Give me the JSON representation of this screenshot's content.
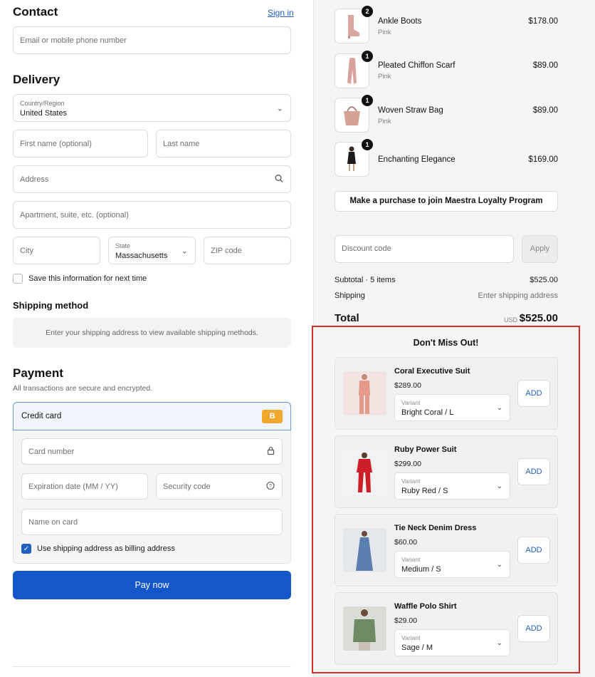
{
  "contact": {
    "title": "Contact",
    "sign_in": "Sign in",
    "email_placeholder": "Email or mobile phone number"
  },
  "delivery": {
    "title": "Delivery",
    "country_label": "Country/Region",
    "country_value": "United States",
    "first_name_placeholder": "First name (optional)",
    "last_name_placeholder": "Last name",
    "address_placeholder": "Address",
    "apartment_placeholder": "Apartment, suite, etc. (optional)",
    "city_placeholder": "City",
    "state_label": "State",
    "state_value": "Massachusetts",
    "zip_placeholder": "ZIP code",
    "save_info_label": "Save this information for next time"
  },
  "shipping": {
    "title": "Shipping method",
    "notice": "Enter your shipping address to view available shipping methods."
  },
  "payment": {
    "title": "Payment",
    "subtitle": "All transactions are secure and encrypted.",
    "method_label": "Credit card",
    "method_badge": "B",
    "card_number_placeholder": "Card number",
    "expiry_placeholder": "Expiration date (MM / YY)",
    "security_placeholder": "Security code",
    "name_placeholder": "Name on card",
    "billing_label": "Use shipping address as billing address",
    "pay_button": "Pay now"
  },
  "order": {
    "items": [
      {
        "name": "Ankle Boots",
        "variant": "Pink",
        "price": "$178.00",
        "qty": "2",
        "icon": "boot-icon"
      },
      {
        "name": "Pleated Chiffon Scarf",
        "variant": "Pink",
        "price": "$89.00",
        "qty": "1",
        "icon": "scarf-icon"
      },
      {
        "name": "Woven Straw Bag",
        "variant": "Pink",
        "price": "$89.00",
        "qty": "1",
        "icon": "bag-icon"
      },
      {
        "name": "Enchanting Elegance",
        "variant": "",
        "price": "$169.00",
        "qty": "1",
        "icon": "dress-icon"
      }
    ],
    "loyalty_button": "Make a purchase to join Maestra Loyalty Program",
    "discount_placeholder": "Discount code",
    "apply_button": "Apply",
    "subtotal_label": "Subtotal · 5 items",
    "subtotal_value": "$525.00",
    "shipping_label": "Shipping",
    "shipping_value": "Enter shipping address",
    "total_label": "Total",
    "total_currency": "USD",
    "total_value": "$525.00"
  },
  "upsell": {
    "title": "Don't Miss Out!",
    "variant_label": "Variant",
    "add_label": "ADD",
    "products": [
      {
        "name": "Coral Executive Suit",
        "price": "$289.00",
        "variant": "Bright Coral / L",
        "color": "#e59a8c",
        "bg": "#f3e4e1"
      },
      {
        "name": "Ruby Power Suit",
        "price": "$299.00",
        "variant": "Ruby Red / S",
        "color": "#cc1f2a",
        "bg": "#f2f2f2"
      },
      {
        "name": "Tie Neck Denim Dress",
        "price": "$60.00",
        "variant": "Medium / S",
        "color": "#5b7fae",
        "bg": "#e4e7ec"
      },
      {
        "name": "Waffle Polo Shirt",
        "price": "$29.00",
        "variant": "Sage / M",
        "color": "#6e8a64",
        "bg": "#d9ddd5"
      }
    ]
  },
  "colors": {
    "accent": "#1357c9",
    "highlight_border": "#d42b2b",
    "badge": "#f0a92e"
  }
}
